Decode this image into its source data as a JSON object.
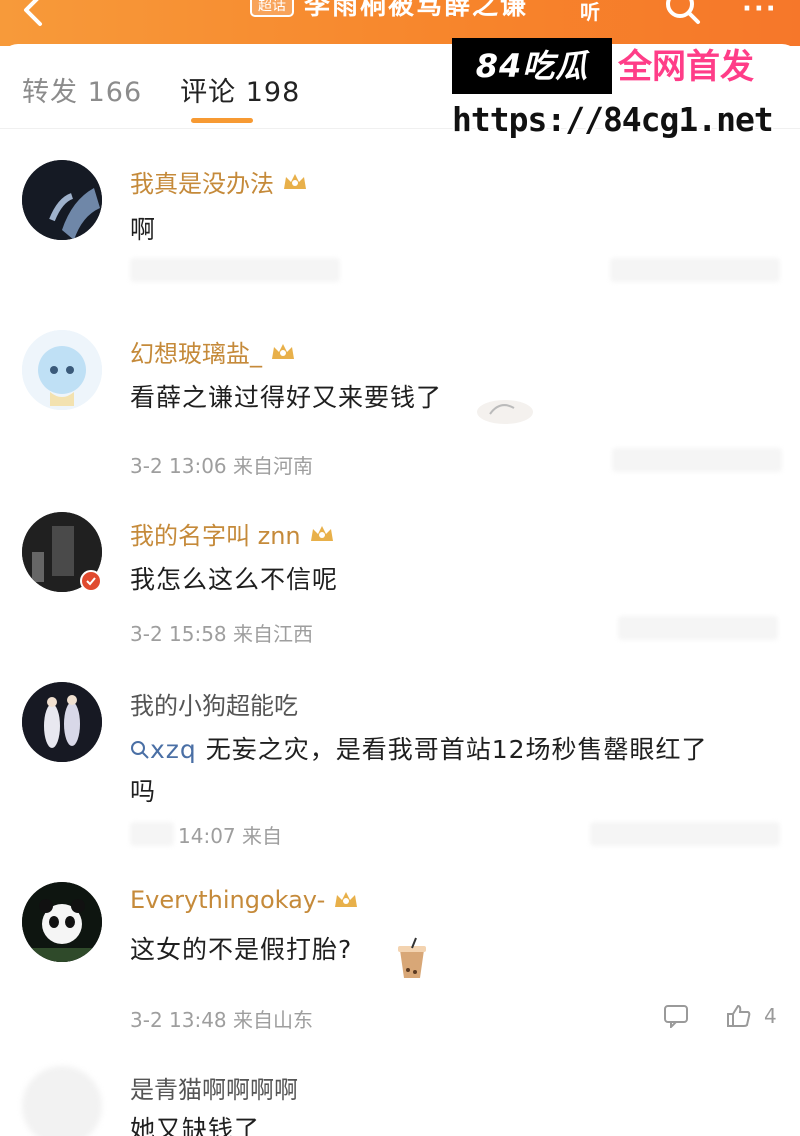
{
  "nav": {
    "back_icon": "chevron-left-icon",
    "badge": "超话",
    "title": "李雨桐被骂薛之谦",
    "listen": "听",
    "search_icon": "search-icon",
    "more": "···"
  },
  "tabs": [
    {
      "label": "转发 166",
      "active": false
    },
    {
      "label": "评论 198",
      "active": true
    }
  ],
  "watermark": {
    "brand": "84吃瓜",
    "slogan": "全网首发",
    "url": "https://84cg1.net"
  },
  "comments": [
    {
      "user": "我真是没办法",
      "text": "啊",
      "meta": "",
      "likes": ""
    },
    {
      "user": "幻想玻璃盐_",
      "text": "看薛之谦过得好又来要钱了",
      "meta": "3-2 13:06 来自河南",
      "likes": ""
    },
    {
      "user": "我的名字叫 znn",
      "text": "我怎么这么不信呢",
      "meta": "3-2 15:58 来自江西",
      "likes": ""
    },
    {
      "user": "我的小狗超能吃",
      "search_term": "xzq",
      "text_after_search": " 无妄之灾，是看我哥首站12场秒售罄眼红了",
      "text_line2": "吗",
      "meta": "14:07 来自",
      "likes": ""
    },
    {
      "user": "Everythingokay-",
      "text": "这女的不是假打胎?",
      "meta": "3-2 13:48 来自山东",
      "likes": "4"
    },
    {
      "user": "是青猫啊啊啊啊",
      "text": "她又缺钱了",
      "meta": "",
      "likes": ""
    }
  ],
  "colors": {
    "accent": "#f79a33",
    "username": "#c58a3a",
    "watermark_pink": "#ff3d88"
  }
}
